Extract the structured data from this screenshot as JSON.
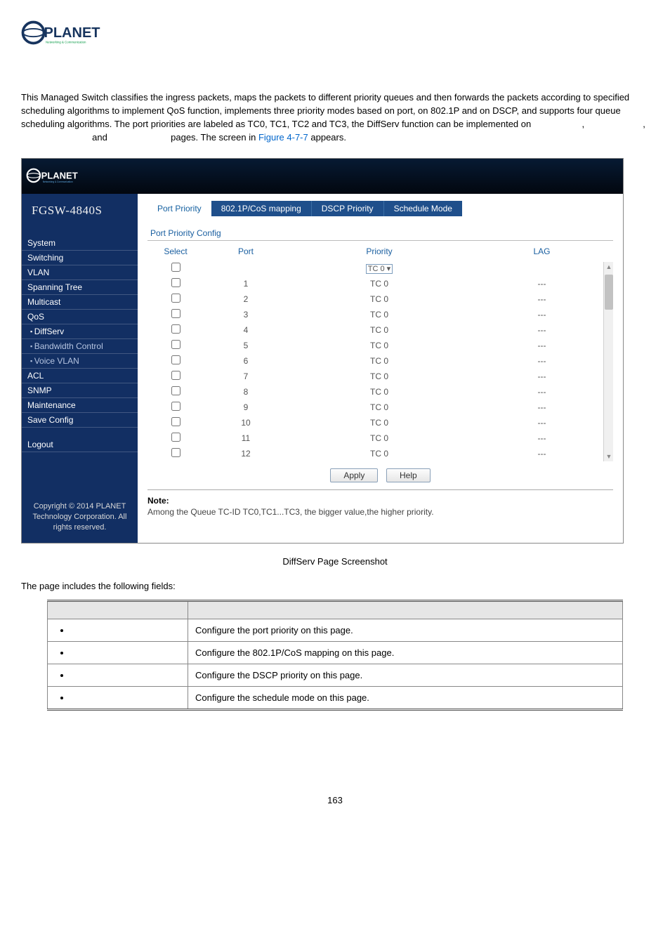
{
  "logo_tagline": "Networking & Communication",
  "intro_text_1a": "This Managed Switch classifies the ingress packets, maps the packets to different priority queues and then forwards the packets according to specified scheduling algorithms to implement QoS function, implements three priority modes based on port, on 802.1P and on DSCP, and supports four queue scheduling algorithms. The port priorities are labeled as TC0, TC1, TC2 and TC3, the DiffServ function can be implemented on",
  "intro_mid1": ",",
  "intro_mid2": ",",
  "intro_mid3": "and",
  "intro_text_1b": "pages. The screen in",
  "intro_figref": "Figure 4-7-7",
  "intro_text_1c": "appears.",
  "screenshot": {
    "model": "FGSW-4840S",
    "nav": [
      {
        "label": "System",
        "sub": false
      },
      {
        "label": "Switching",
        "sub": false
      },
      {
        "label": "VLAN",
        "sub": false
      },
      {
        "label": "Spanning Tree",
        "sub": false
      },
      {
        "label": "Multicast",
        "sub": false
      },
      {
        "label": "QoS",
        "sub": false
      },
      {
        "label": "DiffServ",
        "sub": true,
        "active": true
      },
      {
        "label": "Bandwidth Control",
        "sub": true
      },
      {
        "label": "Voice VLAN",
        "sub": true
      },
      {
        "label": "ACL",
        "sub": false
      },
      {
        "label": "SNMP",
        "sub": false
      },
      {
        "label": "Maintenance",
        "sub": false
      },
      {
        "label": "Save Config",
        "sub": false
      }
    ],
    "logout": "Logout",
    "copyright": "Copyright © 2014 PLANET Technology Corporation. All rights reserved.",
    "tabs": [
      {
        "label": "Port Priority",
        "active": true
      },
      {
        "label": "802.1P/CoS mapping",
        "active": false
      },
      {
        "label": "DSCP Priority",
        "active": false
      },
      {
        "label": "Schedule Mode",
        "active": false
      }
    ],
    "panel_title": "Port Priority Config",
    "headers": {
      "select": "Select",
      "port": "Port",
      "priority": "Priority",
      "lag": "LAG"
    },
    "priority_select": "TC 0 ▾",
    "rows": [
      {
        "port": "1",
        "priority": "TC 0",
        "lag": "---"
      },
      {
        "port": "2",
        "priority": "TC 0",
        "lag": "---"
      },
      {
        "port": "3",
        "priority": "TC 0",
        "lag": "---"
      },
      {
        "port": "4",
        "priority": "TC 0",
        "lag": "---"
      },
      {
        "port": "5",
        "priority": "TC 0",
        "lag": "---"
      },
      {
        "port": "6",
        "priority": "TC 0",
        "lag": "---"
      },
      {
        "port": "7",
        "priority": "TC 0",
        "lag": "---"
      },
      {
        "port": "8",
        "priority": "TC 0",
        "lag": "---"
      },
      {
        "port": "9",
        "priority": "TC 0",
        "lag": "---"
      },
      {
        "port": "10",
        "priority": "TC 0",
        "lag": "---"
      },
      {
        "port": "11",
        "priority": "TC 0",
        "lag": "---"
      },
      {
        "port": "12",
        "priority": "TC 0",
        "lag": "---"
      }
    ],
    "apply": "Apply",
    "help": "Help",
    "note_label": "Note:",
    "note_text": "Among the Queue TC-ID TC0,TC1...TC3, the bigger value,the higher priority."
  },
  "fig_caption": "DiffServ Page Screenshot",
  "fields_intro": "The page includes the following fields:",
  "obj_table": {
    "head_object": "",
    "head_desc": "",
    "rows": [
      {
        "obj": "",
        "desc": "Configure the port priority on this page."
      },
      {
        "obj": "",
        "desc": "Configure the 802.1P/CoS mapping on this page."
      },
      {
        "obj": "",
        "desc": "Configure the DSCP priority on this page."
      },
      {
        "obj": "",
        "desc": "Configure the schedule mode on this page."
      }
    ]
  },
  "page_number": "163"
}
